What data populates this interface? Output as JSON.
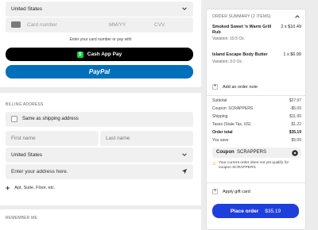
{
  "payment": {
    "country": "United States",
    "card_number_placeholder": "Card number",
    "expiry_placeholder": "MM/YY",
    "cvv_placeholder": "CVV",
    "hint": "Enter your card number or pay with",
    "cashapp_label": "Cash App Pay",
    "paypal_label": "PayPal"
  },
  "billing": {
    "title": "BILLING ADDRESS",
    "same_as_shipping": "Same as shipping address",
    "first_name_placeholder": "First name",
    "last_name_placeholder": "Last name",
    "country": "United States",
    "address_placeholder": "Enter your address here.",
    "apt_label": "Apt, Suite, Floor, etc."
  },
  "remember": {
    "title": "REMEMBER ME"
  },
  "summary": {
    "title": "ORDER SUMMARY (2 ITEMS)",
    "items": [
      {
        "name": "Smoked Sweet 'n Warm Grill Rub",
        "qty": "2 x $10.49",
        "variation": "Variation: 10.5 Oz."
      },
      {
        "name": "Island Escape Body Butter",
        "qty": "1 x $6.99",
        "variation": "Variation: 3.0 Oz."
      }
    ],
    "add_note": "Add an order note",
    "totals": [
      {
        "label": "Subtotal",
        "value": "$27.97"
      },
      {
        "label": "Coupon: SCRAPPERS",
        "value": "-$5.00"
      },
      {
        "label": "Shipping",
        "value": "$11.00"
      },
      {
        "label": "Taxes (State Tax, US)",
        "value": "$1.22"
      },
      {
        "label": "Order total",
        "value": "$35.19"
      },
      {
        "label": "You save",
        "value": "$5.00"
      }
    ],
    "coupon_label": "Coupon",
    "coupon_code": "SCRAPPERS",
    "warning": "Your current order does not yet qualify for coupon SCRAPPERS",
    "gift_card": "Apply gift card",
    "place_order": "Place order",
    "place_order_amount": "$35.19"
  },
  "colors": {
    "accent": "#1f3fdc",
    "paypal": "#0070ba",
    "cashapp": "#00d632"
  }
}
